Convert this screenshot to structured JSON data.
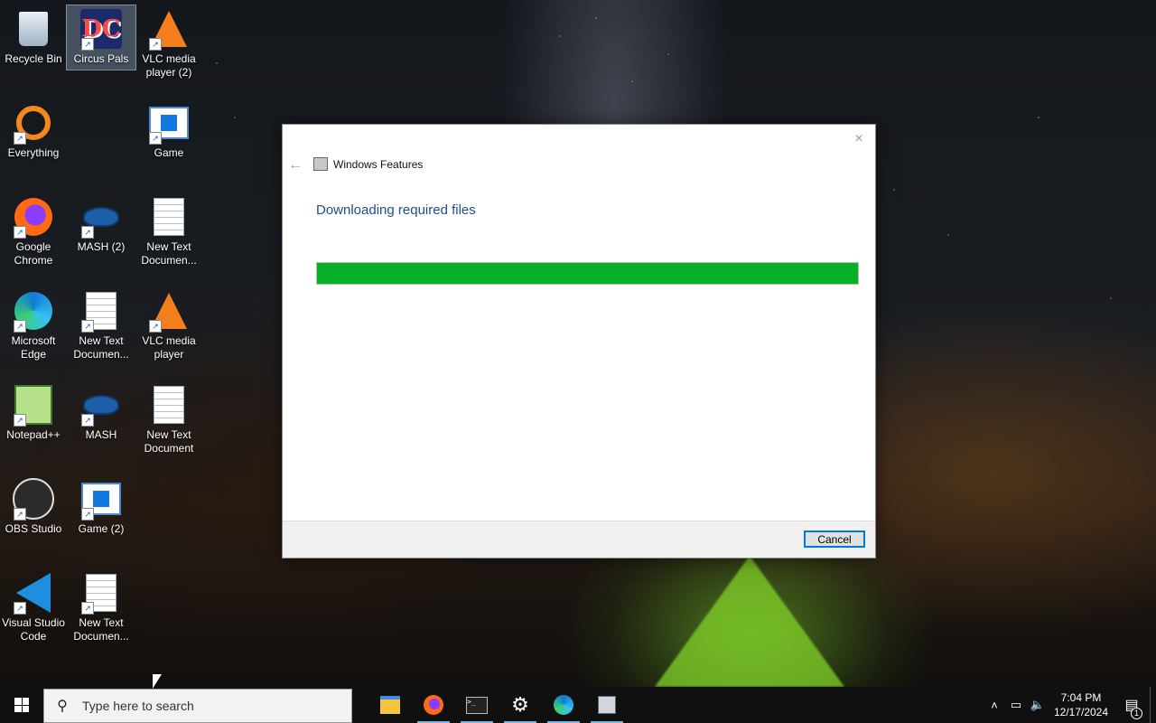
{
  "desktop": {
    "icons": [
      {
        "label": "Recycle Bin",
        "icon": "recycle-bin-icon"
      },
      {
        "label": "Circus Pals",
        "icon": "circus-pals-icon",
        "selected": true,
        "glyph_text": "DC"
      },
      {
        "label": "VLC media player (2)",
        "icon": "vlc-icon"
      },
      {
        "label": "Everything",
        "icon": "everything-icon"
      },
      {
        "label": "Game",
        "icon": "game-icon"
      },
      {
        "label": "Google Chrome",
        "icon": "firefox-icon"
      },
      {
        "label": "MASH (2)",
        "icon": "mash-icon"
      },
      {
        "label": "New Text Documen...",
        "icon": "text-document-icon"
      },
      {
        "label": "Microsoft Edge",
        "icon": "edge-icon"
      },
      {
        "label": "New Text Documen...",
        "icon": "text-document-icon"
      },
      {
        "label": "VLC media player",
        "icon": "vlc-icon"
      },
      {
        "label": "Notepad++",
        "icon": "notepad-plus-plus-icon"
      },
      {
        "label": "MASH",
        "icon": "mash-icon"
      },
      {
        "label": "New Text Document",
        "icon": "text-document-icon"
      },
      {
        "label": "OBS Studio",
        "icon": "obs-studio-icon"
      },
      {
        "label": "Game (2)",
        "icon": "game-icon"
      },
      {
        "label": "Visual Studio Code",
        "icon": "vscode-icon"
      },
      {
        "label": "New Text Documen...",
        "icon": "text-document-icon"
      }
    ]
  },
  "dialog": {
    "title": "Windows Features",
    "heading": "Downloading required files",
    "progress": 1.0,
    "progress_color": "#06b025",
    "cancel_label": "Cancel",
    "back_glyph": "←",
    "close_glyph": "×"
  },
  "taskbar": {
    "search_placeholder": "Type here to search",
    "apps": [
      {
        "name": "file-explorer",
        "running": false
      },
      {
        "name": "firefox",
        "running": true
      },
      {
        "name": "terminal",
        "running": true
      },
      {
        "name": "settings",
        "running": true
      },
      {
        "name": "edge",
        "running": true
      },
      {
        "name": "windows-features",
        "running": true
      }
    ],
    "terminal_glyph": ">_",
    "time": "7:04 PM",
    "date": "12/17/2024",
    "notification_count": "1"
  }
}
